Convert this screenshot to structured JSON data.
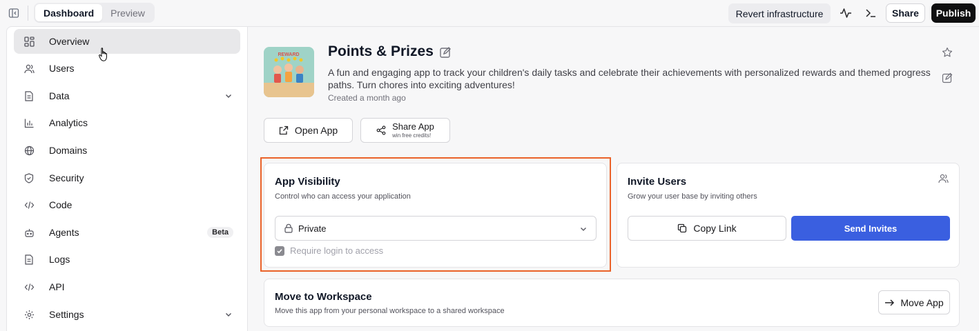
{
  "topbar": {
    "tabs": [
      {
        "label": "Dashboard",
        "active": true
      },
      {
        "label": "Preview",
        "active": false
      }
    ],
    "revert_label": "Revert infrastructure",
    "share_label": "Share",
    "publish_label": "Publish"
  },
  "sidebar": {
    "items": [
      {
        "label": "Overview",
        "icon": "grid-icon",
        "active": true
      },
      {
        "label": "Users",
        "icon": "users-icon"
      },
      {
        "label": "Data",
        "icon": "file-icon",
        "expandable": true
      },
      {
        "label": "Analytics",
        "icon": "bar-chart-icon"
      },
      {
        "label": "Domains",
        "icon": "globe-icon"
      },
      {
        "label": "Security",
        "icon": "shield-icon"
      },
      {
        "label": "Code",
        "icon": "code-icon"
      },
      {
        "label": "Agents",
        "icon": "bot-icon",
        "badge": "Beta"
      },
      {
        "label": "Logs",
        "icon": "file-icon"
      },
      {
        "label": "API",
        "icon": "code-icon"
      },
      {
        "label": "Settings",
        "icon": "gear-icon",
        "expandable": true
      }
    ]
  },
  "app": {
    "title": "Points & Prizes",
    "description": "A fun and engaging app to track your children's daily tasks and celebrate their achievements with personalized rewards and themed progress paths. Turn chores into exciting adventures!",
    "created": "Created a month ago",
    "thumbnail_text": "REWARD",
    "open_label": "Open App",
    "share_app_label": "Share App",
    "share_app_sub": "win free credits!"
  },
  "visibility": {
    "title": "App Visibility",
    "subtitle": "Control who can access your application",
    "selected": "Private",
    "require_login_label": "Require login to access",
    "require_login_checked": true,
    "highlight_color": "#ea6229"
  },
  "invite": {
    "title": "Invite Users",
    "subtitle": "Grow your user base by inviting others",
    "copy_label": "Copy Link",
    "send_label": "Send Invites",
    "accent": "#3a5fe0"
  },
  "workspace": {
    "title": "Move to Workspace",
    "subtitle": "Move this app from your personal workspace to a shared workspace",
    "move_label": "Move App"
  }
}
